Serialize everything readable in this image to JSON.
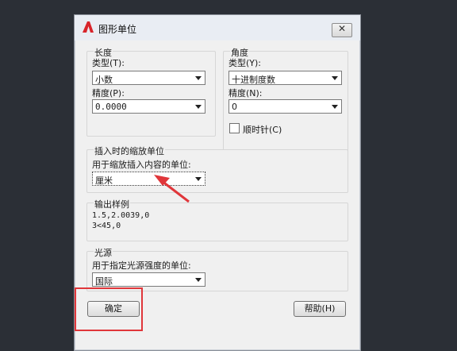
{
  "dialog": {
    "title": "图形单位",
    "app_icon_letter": "A",
    "close_symbol": "✕"
  },
  "length": {
    "group_title": "长度",
    "type_label": "类型(T):",
    "type_value": "小数",
    "precision_label": "精度(P):",
    "precision_value": "0.0000"
  },
  "angle": {
    "group_title": "角度",
    "type_label": "类型(Y):",
    "type_value": "十进制度数",
    "precision_label": "精度(N):",
    "precision_value": "0",
    "clockwise_label": "顺时针(C)",
    "clockwise_checked": false
  },
  "insertion": {
    "group_title": "插入时的缩放单位",
    "units_label": "用于缩放插入内容的单位:",
    "units_value": "厘米"
  },
  "sample": {
    "group_title": "输出样例",
    "line1": "1.5,2.0039,0",
    "line2": "3<45,0"
  },
  "lighting": {
    "group_title": "光源",
    "units_label": "用于指定光源强度的单位:",
    "units_value": "国际"
  },
  "buttons": {
    "ok": "确定",
    "help": "帮助(H)"
  },
  "annotation_colors": {
    "arrow": "#e0363a",
    "highlight_box": "#e0363a"
  }
}
